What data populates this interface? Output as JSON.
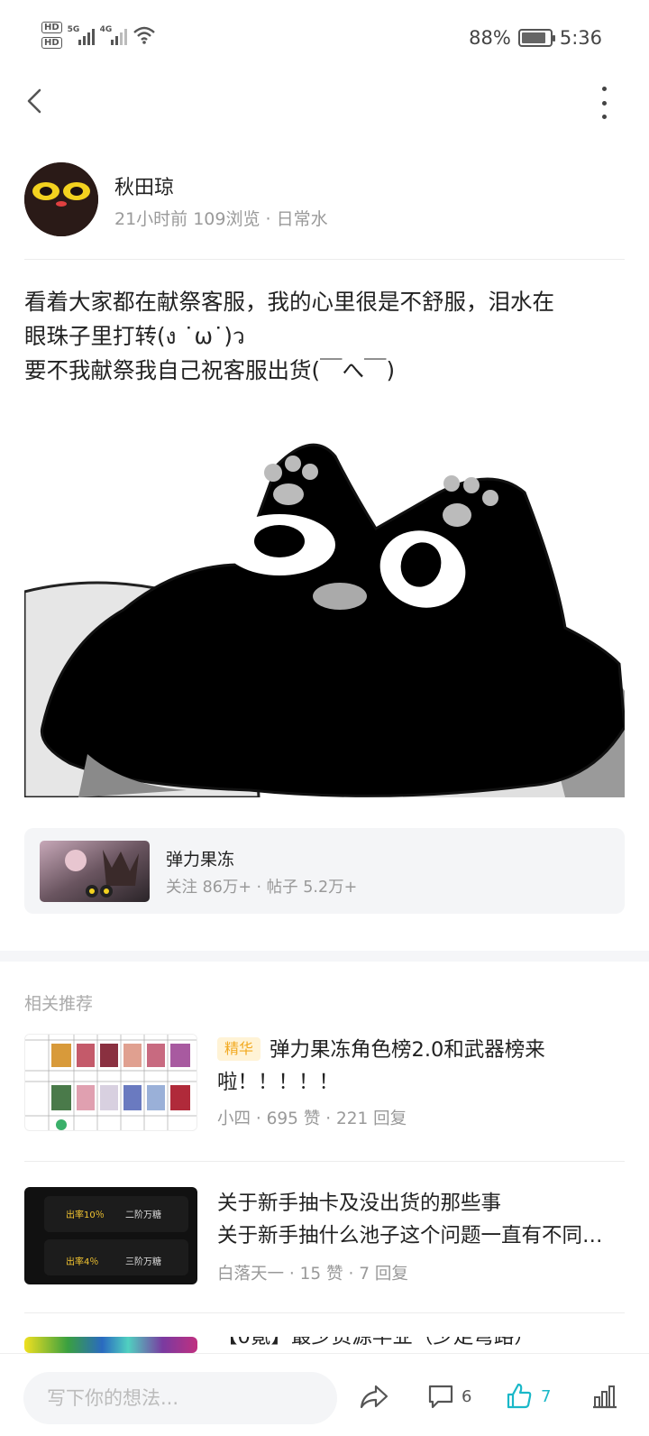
{
  "status_bar": {
    "hd1": "HD",
    "hd2": "HD",
    "sig1_label": "5G",
    "sig2_label": "4G",
    "battery": "88%",
    "time": "5:36"
  },
  "author": {
    "name": "秋田琼",
    "meta": "21小时前  109浏览 · 日常水"
  },
  "post": {
    "lines": [
      "看着大家都在献祭客服，我的心里很是不舒服，泪水在",
      "眼珠子里打转(ง ˙ω˙)ว",
      "要不我献祭我自己祝客服出货(￣へ￣)"
    ]
  },
  "forum": {
    "name": "弹力果冻",
    "stats": "关注 86万+ · 帖子 5.2万+"
  },
  "related": {
    "title": "相关推荐",
    "items": [
      {
        "tag": "精华",
        "title_line1": "弹力果冻角色榜2.0和武器榜来",
        "title_line2": "啦！！！！！",
        "meta": "小四 · 695 赞 · 221 回复"
      },
      {
        "title_line1": "关于新手抽卡及没出货的那些事",
        "title_line2": "关于新手抽什么池子这个问题一直有不同…",
        "meta": "白落天一 · 15 赞 · 7 回复",
        "thumb_rows": [
          {
            "rate": "出率10％",
            "tier": "二阶万糖"
          },
          {
            "rate": "出率4％",
            "tier": "三阶万糖"
          }
        ]
      },
      {
        "title_line1": "【0氪】最少资源毕业（少走弯路）"
      }
    ]
  },
  "bottom_bar": {
    "placeholder": "写下你的想法...",
    "comment_count": "6",
    "like_count": "7"
  },
  "colors": {
    "accent": "#1ab8c8",
    "tag_bg": "#fff3d6",
    "tag_text": "#f2a91f"
  }
}
